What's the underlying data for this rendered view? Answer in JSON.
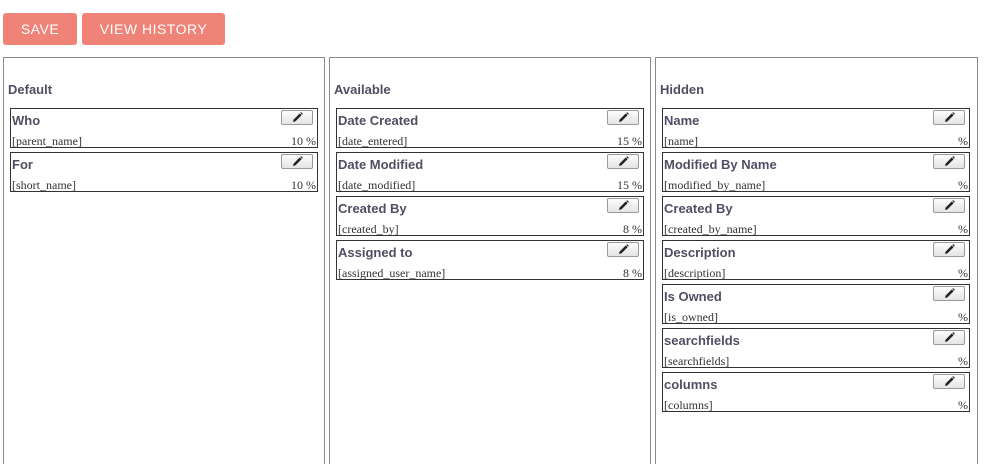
{
  "toolbar": {
    "save_label": "SAVE",
    "history_label": "VIEW HISTORY"
  },
  "colors": {
    "button_bg": "#f08377",
    "text": "#534d64"
  },
  "panels": [
    {
      "title": "Default",
      "fields": [
        {
          "label": "Who",
          "name": "[parent_name]",
          "width": "10 %"
        },
        {
          "label": "For",
          "name": "[short_name]",
          "width": "10 %"
        }
      ]
    },
    {
      "title": "Available",
      "fields": [
        {
          "label": "Date Created",
          "name": "[date_entered]",
          "width": "15 %"
        },
        {
          "label": "Date Modified",
          "name": "[date_modified]",
          "width": "15 %"
        },
        {
          "label": "Created By",
          "name": "[created_by]",
          "width": "8 %"
        },
        {
          "label": "Assigned to",
          "name": "[assigned_user_name]",
          "width": "8 %"
        }
      ]
    },
    {
      "title": "Hidden",
      "fields": [
        {
          "label": "Name",
          "name": "[name]",
          "width": "%"
        },
        {
          "label": "Modified By Name",
          "name": "[modified_by_name]",
          "width": "%"
        },
        {
          "label": "Created By",
          "name": "[created_by_name]",
          "width": "%"
        },
        {
          "label": "Description",
          "name": "[description]",
          "width": "%"
        },
        {
          "label": "Is Owned",
          "name": "[is_owned]",
          "width": "%"
        },
        {
          "label": "searchfields",
          "name": "[searchfields]",
          "width": "%"
        },
        {
          "label": "columns",
          "name": "[columns]",
          "width": "%"
        }
      ]
    }
  ],
  "icons": {
    "edit": "pencil-icon"
  }
}
